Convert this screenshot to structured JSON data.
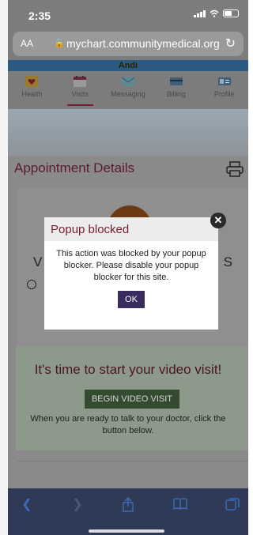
{
  "status": {
    "time": "2:35"
  },
  "browser": {
    "text_size": "AA",
    "url": "mychart.communitymedical.org"
  },
  "user": {
    "name": "Andi"
  },
  "tabs": [
    {
      "label": "Health",
      "icon": "heart-icon"
    },
    {
      "label": "Visits",
      "icon": "calendar-icon"
    },
    {
      "label": "Messaging",
      "icon": "envelope-icon"
    },
    {
      "label": "Billing",
      "icon": "card-icon"
    },
    {
      "label": "Profile",
      "icon": "id-card-icon"
    }
  ],
  "page": {
    "title": "Appointment Details",
    "card_letter_left": "V",
    "card_letter_right": "S",
    "video_title": "It's time to start your video visit!",
    "begin_button": "BEGIN VIDEO VISIT",
    "video_desc": "When you are ready to talk to your doctor, click the button below."
  },
  "modal": {
    "title": "Popup blocked",
    "message": "This action was blocked by your popup blocker. Please disable your popup blocker for this site.",
    "ok": "OK"
  },
  "colors": {
    "brand": "#7b1c2f",
    "button": "#3a2b5e",
    "toolbar_icon": "#3d6bb5"
  }
}
